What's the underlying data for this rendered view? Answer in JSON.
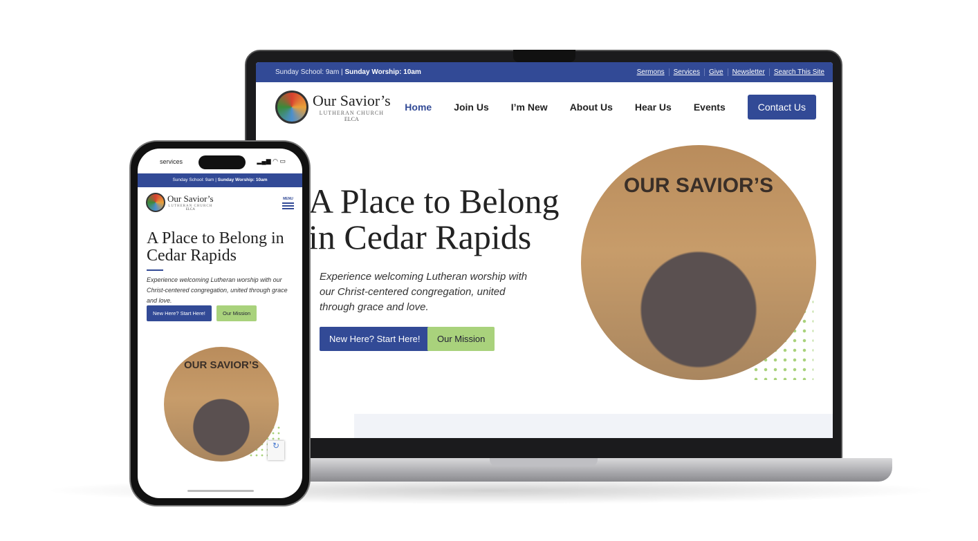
{
  "site": {
    "schedule_prefix": "Sunday School: 9am |",
    "schedule_bold": "Sunday Worship: 10am",
    "top_links": [
      "Sermons",
      "Services",
      "Give",
      "Newsletter",
      "Search This Site"
    ],
    "brand_name": "Our Savior’s",
    "brand_sub": "LUTHERAN CHURCH",
    "brand_elca": "ELCA",
    "nav": [
      "Home",
      "Join Us",
      "I’m New",
      "About Us",
      "Hear Us",
      "Events"
    ],
    "contact": "Contact Us",
    "hero_title": "A Place to Belong in Cedar Rapids",
    "hero_text": "Experience welcoming Lutheran worship with our Christ-centered congregation, united through grace and love.",
    "btn_primary": "New Here? Start Here!",
    "btn_secondary": "Our Mission",
    "photo_sign": "OUR SAVIOR’S",
    "menu_label": "MENU"
  },
  "phone": {
    "status_label": "services",
    "status_icons": "▂▄▆ ◠ ▭"
  },
  "colors": {
    "primary": "#324a96",
    "accent": "#a9d27c"
  }
}
